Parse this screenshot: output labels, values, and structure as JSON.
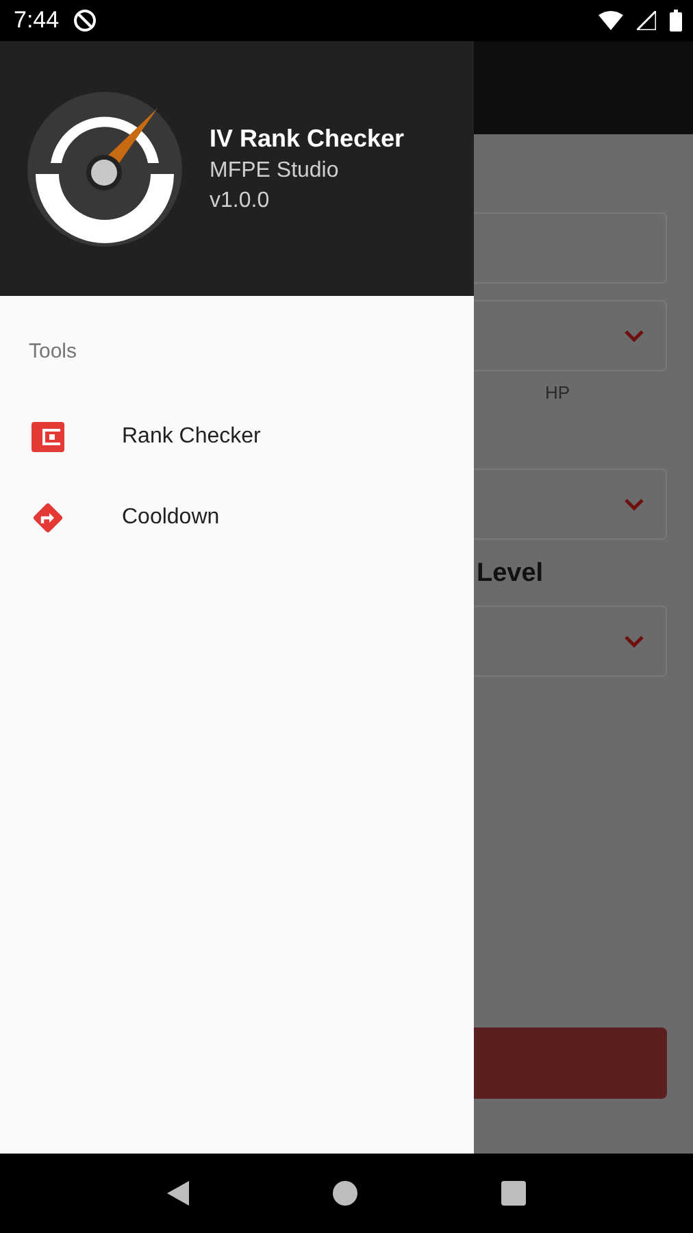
{
  "status_bar": {
    "time": "7:44"
  },
  "drawer": {
    "header": {
      "title": "IV Rank Checker",
      "subtitle": "MFPE Studio",
      "version": "v1.0.0"
    },
    "section_title": "Tools",
    "items": [
      {
        "label": "Rank Checker"
      },
      {
        "label": "Cooldown"
      }
    ]
  },
  "background": {
    "hp_label": "HP",
    "level_label": "Level"
  }
}
